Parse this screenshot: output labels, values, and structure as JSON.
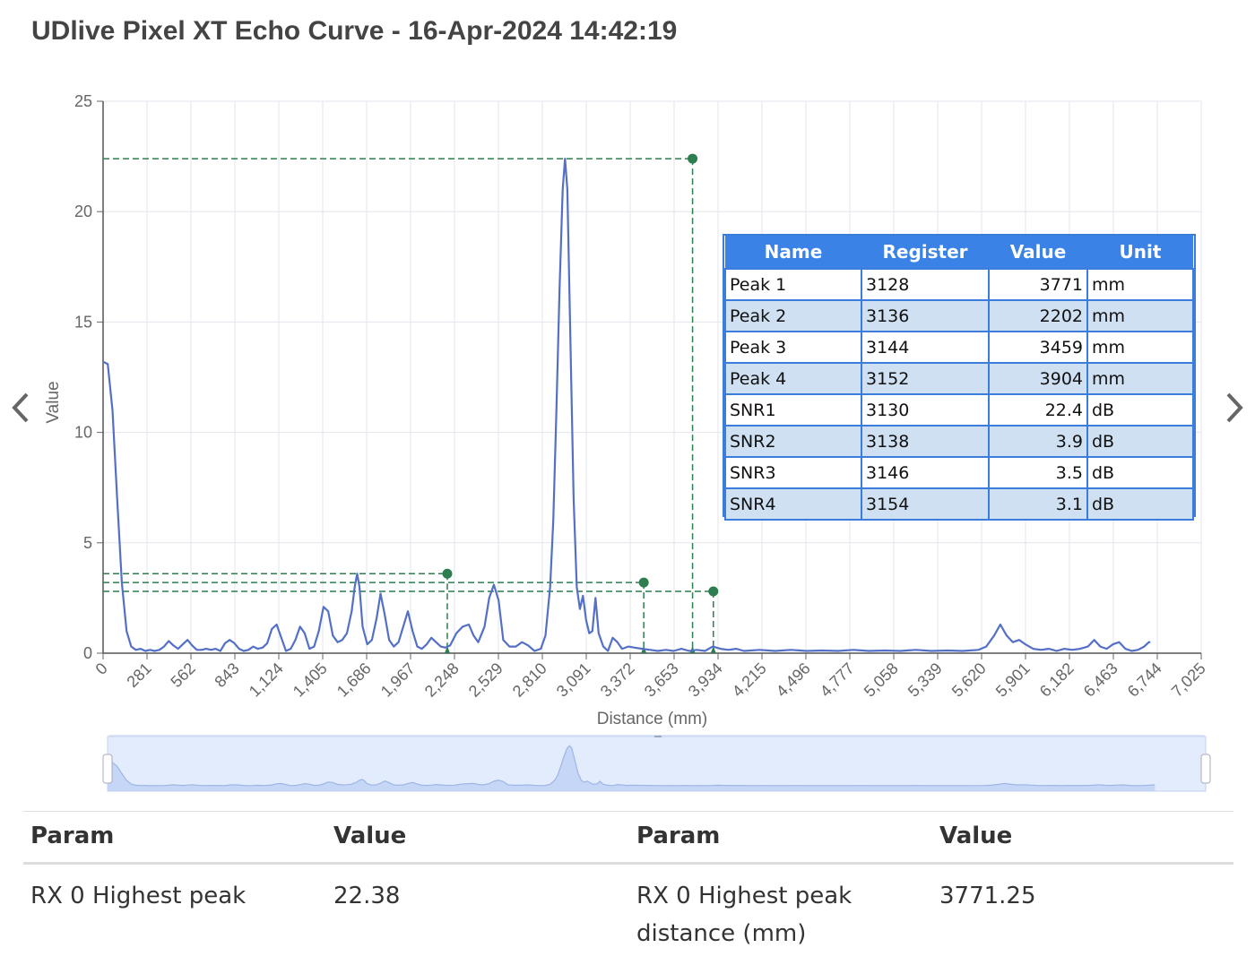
{
  "page": {
    "title": "UDlive Pixel XT Echo Curve - 16-Apr-2024 14:42:19"
  },
  "nav": {
    "prev_icon": "chevron-left-icon",
    "next_icon": "chevron-right-icon"
  },
  "colors": {
    "curve": "#5470c6",
    "marker": "#2e7d4f",
    "header_blue": "#3b82e6",
    "row_alt": "#cfe0f3"
  },
  "chart_data": {
    "type": "line",
    "xlabel": "Distance (mm)",
    "ylabel": "Value",
    "xlim": [
      0,
      7025
    ],
    "ylim": [
      0,
      25
    ],
    "x_ticks": [
      "0",
      "281",
      "562",
      "843",
      "1,124",
      "1,405",
      "1,686",
      "1,967",
      "2,248",
      "2,529",
      "2,810",
      "3,091",
      "3,372",
      "3,653",
      "3,934",
      "4,215",
      "4,496",
      "4,777",
      "5,058",
      "5,339",
      "5,620",
      "5,901",
      "6,182",
      "6,463",
      "6,744",
      "7,025"
    ],
    "y_ticks": [
      "0",
      "5",
      "10",
      "15",
      "20",
      "25"
    ],
    "grid": true,
    "series": [
      {
        "points": [
          [
            0,
            13.2
          ],
          [
            30,
            13.1
          ],
          [
            60,
            11
          ],
          [
            90,
            7
          ],
          [
            120,
            3.2
          ],
          [
            150,
            1.0
          ],
          [
            180,
            0.3
          ],
          [
            210,
            0.15
          ],
          [
            240,
            0.2
          ],
          [
            270,
            0.1
          ],
          [
            300,
            0.15
          ],
          [
            330,
            0.1
          ],
          [
            360,
            0.15
          ],
          [
            390,
            0.3
          ],
          [
            420,
            0.55
          ],
          [
            450,
            0.35
          ],
          [
            480,
            0.2
          ],
          [
            510,
            0.4
          ],
          [
            540,
            0.6
          ],
          [
            570,
            0.35
          ],
          [
            600,
            0.15
          ],
          [
            630,
            0.15
          ],
          [
            660,
            0.2
          ],
          [
            690,
            0.15
          ],
          [
            720,
            0.2
          ],
          [
            750,
            0.1
          ],
          [
            780,
            0.45
          ],
          [
            810,
            0.6
          ],
          [
            840,
            0.45
          ],
          [
            870,
            0.2
          ],
          [
            900,
            0.1
          ],
          [
            930,
            0.15
          ],
          [
            960,
            0.3
          ],
          [
            990,
            0.2
          ],
          [
            1020,
            0.25
          ],
          [
            1050,
            0.45
          ],
          [
            1080,
            1.1
          ],
          [
            1110,
            1.3
          ],
          [
            1140,
            0.7
          ],
          [
            1170,
            0.1
          ],
          [
            1200,
            0.2
          ],
          [
            1230,
            0.6
          ],
          [
            1260,
            1.2
          ],
          [
            1290,
            0.9
          ],
          [
            1320,
            0.2
          ],
          [
            1350,
            0.3
          ],
          [
            1380,
            1.0
          ],
          [
            1410,
            2.1
          ],
          [
            1440,
            1.9
          ],
          [
            1470,
            0.8
          ],
          [
            1500,
            0.5
          ],
          [
            1530,
            0.6
          ],
          [
            1560,
            0.9
          ],
          [
            1590,
            1.9
          ],
          [
            1610,
            3.0
          ],
          [
            1625,
            3.6
          ],
          [
            1640,
            3.0
          ],
          [
            1660,
            1.2
          ],
          [
            1690,
            0.4
          ],
          [
            1720,
            0.6
          ],
          [
            1750,
            1.6
          ],
          [
            1775,
            2.7
          ],
          [
            1800,
            1.8
          ],
          [
            1830,
            0.6
          ],
          [
            1860,
            0.3
          ],
          [
            1890,
            0.5
          ],
          [
            1920,
            1.2
          ],
          [
            1950,
            1.9
          ],
          [
            1980,
            1.0
          ],
          [
            2010,
            0.3
          ],
          [
            2040,
            0.2
          ],
          [
            2070,
            0.4
          ],
          [
            2100,
            0.7
          ],
          [
            2130,
            0.5
          ],
          [
            2160,
            0.3
          ],
          [
            2190,
            0.25
          ],
          [
            2220,
            0.35
          ],
          [
            2260,
            0.9
          ],
          [
            2300,
            1.2
          ],
          [
            2340,
            1.3
          ],
          [
            2370,
            0.8
          ],
          [
            2400,
            0.5
          ],
          [
            2440,
            1.2
          ],
          [
            2470,
            2.5
          ],
          [
            2500,
            3.1
          ],
          [
            2530,
            2.4
          ],
          [
            2560,
            0.6
          ],
          [
            2600,
            0.3
          ],
          [
            2640,
            0.3
          ],
          [
            2680,
            0.5
          ],
          [
            2720,
            0.35
          ],
          [
            2760,
            0.1
          ],
          [
            2800,
            0.2
          ],
          [
            2830,
            0.8
          ],
          [
            2860,
            3.0
          ],
          [
            2880,
            6.0
          ],
          [
            2900,
            11
          ],
          [
            2920,
            16.5
          ],
          [
            2940,
            21.0
          ],
          [
            2955,
            22.4
          ],
          [
            2970,
            21.0
          ],
          [
            2990,
            14
          ],
          [
            3010,
            7
          ],
          [
            3030,
            3
          ],
          [
            3050,
            2.0
          ],
          [
            3070,
            2.6
          ],
          [
            3090,
            1.5
          ],
          [
            3110,
            0.9
          ],
          [
            3130,
            1.0
          ],
          [
            3150,
            2.5
          ],
          [
            3170,
            0.9
          ],
          [
            3200,
            0.3
          ],
          [
            3230,
            0.1
          ],
          [
            3260,
            0.7
          ],
          [
            3290,
            0.5
          ],
          [
            3320,
            0.2
          ],
          [
            3360,
            0.3
          ],
          [
            3400,
            0.25
          ],
          [
            3450,
            0.2
          ],
          [
            3500,
            0.15
          ],
          [
            3550,
            0.1
          ],
          [
            3600,
            0.15
          ],
          [
            3650,
            0.1
          ],
          [
            3700,
            0.2
          ],
          [
            3750,
            0.1
          ],
          [
            3800,
            0.15
          ],
          [
            3850,
            0.1
          ],
          [
            3900,
            0.3
          ],
          [
            3950,
            0.2
          ],
          [
            4000,
            0.15
          ],
          [
            4050,
            0.2
          ],
          [
            4100,
            0.1
          ],
          [
            4200,
            0.15
          ],
          [
            4300,
            0.1
          ],
          [
            4400,
            0.15
          ],
          [
            4500,
            0.1
          ],
          [
            4600,
            0.12
          ],
          [
            4700,
            0.1
          ],
          [
            4800,
            0.15
          ],
          [
            4900,
            0.1
          ],
          [
            5000,
            0.12
          ],
          [
            5100,
            0.1
          ],
          [
            5200,
            0.15
          ],
          [
            5300,
            0.1
          ],
          [
            5400,
            0.12
          ],
          [
            5500,
            0.1
          ],
          [
            5600,
            0.15
          ],
          [
            5650,
            0.3
          ],
          [
            5700,
            0.8
          ],
          [
            5740,
            1.3
          ],
          [
            5780,
            0.8
          ],
          [
            5820,
            0.5
          ],
          [
            5860,
            0.6
          ],
          [
            5900,
            0.4
          ],
          [
            5950,
            0.2
          ],
          [
            6000,
            0.15
          ],
          [
            6050,
            0.2
          ],
          [
            6100,
            0.1
          ],
          [
            6150,
            0.2
          ],
          [
            6200,
            0.15
          ],
          [
            6250,
            0.2
          ],
          [
            6300,
            0.3
          ],
          [
            6340,
            0.6
          ],
          [
            6380,
            0.3
          ],
          [
            6420,
            0.2
          ],
          [
            6460,
            0.4
          ],
          [
            6500,
            0.5
          ],
          [
            6540,
            0.2
          ],
          [
            6580,
            0.1
          ],
          [
            6620,
            0.15
          ],
          [
            6660,
            0.3
          ],
          [
            6690,
            0.5
          ],
          [
            6700,
            0.5
          ]
        ]
      }
    ],
    "peaks": [
      {
        "x": 3771,
        "y": 22.4
      },
      {
        "x": 2202,
        "y": 3.6
      },
      {
        "x": 3459,
        "y": 3.2
      },
      {
        "x": 3904,
        "y": 2.8
      }
    ]
  },
  "peak_table": {
    "headers": [
      "Name",
      "Register",
      "Value",
      "Unit"
    ],
    "rows": [
      [
        "Peak 1",
        "3128",
        "3771",
        "mm"
      ],
      [
        "Peak 2",
        "3136",
        "2202",
        "mm"
      ],
      [
        "Peak 3",
        "3144",
        "3459",
        "mm"
      ],
      [
        "Peak 4",
        "3152",
        "3904",
        "mm"
      ],
      [
        "SNR1",
        "3130",
        "22.4",
        "dB"
      ],
      [
        "SNR2",
        "3138",
        "3.9",
        "dB"
      ],
      [
        "SNR3",
        "3146",
        "3.5",
        "dB"
      ],
      [
        "SNR4",
        "3154",
        "3.1",
        "dB"
      ]
    ]
  },
  "params": {
    "headers": [
      "Param",
      "Value",
      "Param",
      "Value"
    ],
    "rows": [
      [
        "RX 0 Highest peak",
        "22.38",
        "RX 0 Highest peak distance (mm)",
        "3771.25"
      ]
    ]
  }
}
